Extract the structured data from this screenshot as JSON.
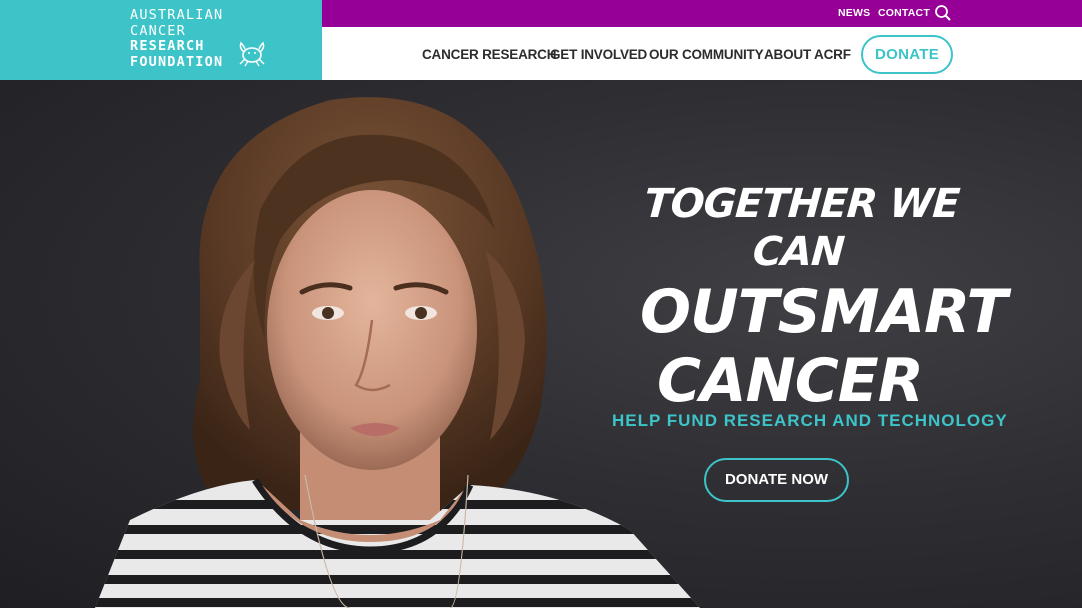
{
  "logo": {
    "line1": "AUSTRALIAN",
    "line2": "CANCER",
    "line3": "RESEARCH",
    "line4": "FOUNDATION",
    "icon": "crab-logo-icon",
    "bg_color": "#3cc4c9"
  },
  "utility_bar": {
    "news": "NEWS",
    "contact": "CONTACT",
    "search_icon": "search-icon",
    "bg_color": "#970097"
  },
  "nav": {
    "items": [
      {
        "label": "CANCER RESEARCH"
      },
      {
        "label": "GET INVOLVED"
      },
      {
        "label": "OUR COMMUNITY"
      },
      {
        "label": "ABOUT ACRF"
      }
    ],
    "donate": "DONATE"
  },
  "hero": {
    "headline_line1": "TOGETHER WE CAN",
    "headline_line2": "OUTSMART",
    "headline_line3": "CANCER",
    "subheading": "HELP FUND RESEARCH AND TECHNOLOGY",
    "cta": "DONATE NOW",
    "accent_color": "#3cc4c9"
  }
}
